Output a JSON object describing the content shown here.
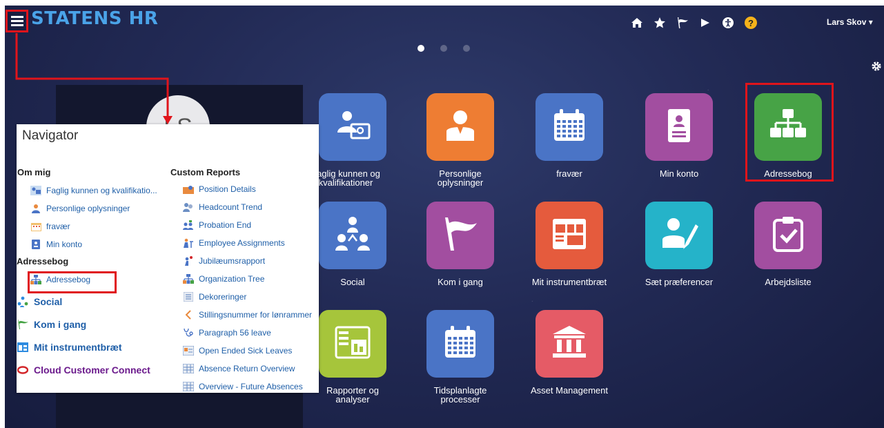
{
  "header": {
    "logo": "STATENS HR",
    "user": "Lars Skov ▾",
    "help_glyph": "?",
    "icons": [
      "home-icon",
      "star-icon",
      "flag-icon",
      "megaphone-icon",
      "accessibility-icon",
      "help-icon"
    ]
  },
  "avatar_initials": "LS",
  "colors": {
    "accent": "#e0141b",
    "logo": "#4aa3e8",
    "link": "#1f5fa8"
  },
  "tiles": [
    {
      "label": "Faglig kunnen og kvalifikationer",
      "color": "#4a74c6",
      "icon": "skills-certificate-icon"
    },
    {
      "label": "Personlige oplysninger",
      "color": "#ee7d33",
      "icon": "person-icon"
    },
    {
      "label": "fravær",
      "color": "#4a74c6",
      "icon": "calendar-icon"
    },
    {
      "label": "Min konto",
      "color": "#a24ea0",
      "icon": "id-card-icon"
    },
    {
      "label": "Adressebog",
      "color": "#47a346",
      "icon": "org-chart-icon"
    },
    {
      "label": "Social",
      "color": "#4a74c6",
      "icon": "people-network-icon"
    },
    {
      "label": "Kom i gang",
      "color": "#a24ea0",
      "icon": "flag-icon"
    },
    {
      "label": "Mit instrumentbræt",
      "color": "#e55b3d",
      "icon": "dashboard-icon"
    },
    {
      "label": "Sæt præferencer",
      "color": "#25b3c9",
      "icon": "person-pencil-icon"
    },
    {
      "label": "Arbejdsliste",
      "color": "#a24ea0",
      "icon": "clipboard-check-icon"
    },
    {
      "label": "Rapporter og analyser",
      "color": "#a6c53b",
      "icon": "report-icon"
    },
    {
      "label": "Tidsplanlagte processer",
      "color": "#4a74c6",
      "icon": "calendar-icon"
    },
    {
      "label": "Asset Management",
      "color": "#e55b66",
      "icon": "bank-building-icon"
    }
  ],
  "navigator": {
    "title": "Navigator",
    "om_mig": {
      "heading": "Om mig",
      "items": [
        {
          "label": "Faglig kunnen og kvalifikatio...",
          "icon": "skills-certificate-icon"
        },
        {
          "label": "Personlige oplysninger",
          "icon": "person-icon"
        },
        {
          "label": "fravær",
          "icon": "calendar-icon"
        },
        {
          "label": "Min konto",
          "icon": "id-card-icon"
        }
      ]
    },
    "adressebog": {
      "heading": "Adressebog",
      "items": [
        {
          "label": "Adressebog",
          "icon": "org-chart-icon"
        }
      ]
    },
    "groups": [
      {
        "label": "Social",
        "icon": "people-network-icon"
      },
      {
        "label": "Kom i gang",
        "icon": "flag-icon"
      },
      {
        "label": "Mit instrumentbræt",
        "icon": "dashboard-icon"
      },
      {
        "label": "Cloud Customer Connect",
        "icon": "oracle-ring-icon"
      }
    ],
    "custom_reports": {
      "heading": "Custom Reports",
      "items": [
        {
          "label": "Position Details",
          "icon": "position-icon"
        },
        {
          "label": "Headcount Trend",
          "icon": "headcount-icon"
        },
        {
          "label": "Probation End",
          "icon": "probation-icon"
        },
        {
          "label": "Employee Assignments",
          "icon": "assignment-icon"
        },
        {
          "label": "Jubilæumsrapport",
          "icon": "anniversary-icon"
        },
        {
          "label": "Organization Tree",
          "icon": "org-chart-icon"
        },
        {
          "label": "Dekoreringer",
          "icon": "list-icon"
        },
        {
          "label": "Stillingsnummer for lønrammer",
          "icon": "chevron-left-icon"
        },
        {
          "label": "Paragraph 56 leave",
          "icon": "medical-icon"
        },
        {
          "label": "Open Ended Sick Leaves",
          "icon": "sick-leave-icon"
        },
        {
          "label": "Absence Return Overview",
          "icon": "report-grid-icon"
        },
        {
          "label": "Overview - Future Absences",
          "icon": "report-grid-icon"
        }
      ]
    }
  }
}
